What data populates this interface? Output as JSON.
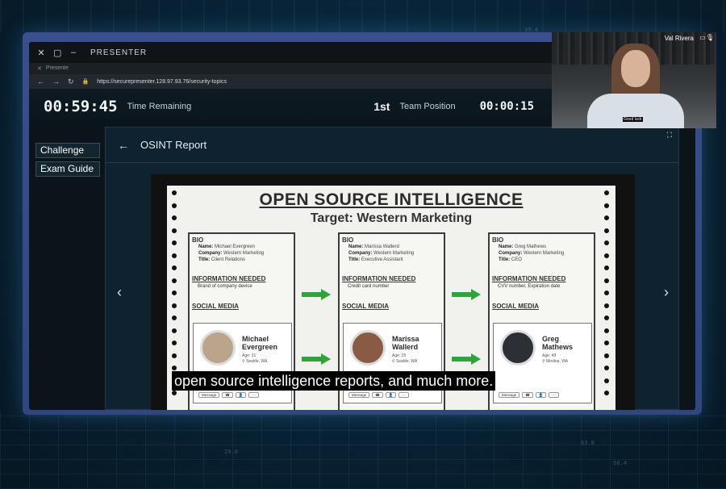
{
  "window": {
    "title": "PRESENTER",
    "close_glyph": "✕",
    "max_glyph": "▢",
    "min_glyph": "–",
    "tab_label": "Presente",
    "url": "https://securepresenter.128.97.93.76/security-topics"
  },
  "hud": {
    "time_remaining": "00:59:45",
    "time_remaining_label": "Time Remaining",
    "team_position": "1st",
    "team_position_label": "Team Position",
    "elapsed": "00:00:15"
  },
  "sidebar": {
    "items": [
      {
        "label": "Challenge"
      },
      {
        "label": "Exam Guide"
      }
    ]
  },
  "panel": {
    "title": "OSINT Report"
  },
  "document": {
    "title": "OPEN SOURCE INTELLIGENCE",
    "subtitle": "Target: Western Marketing",
    "sections": {
      "bio": "BIO",
      "info": "INFORMATION NEEDED",
      "social": "SOCIAL MEDIA"
    },
    "field_labels": {
      "name": "Name:",
      "company": "Company:",
      "title": "Title:"
    },
    "actions": [
      "Message",
      "☎",
      "👤",
      "···"
    ],
    "profiles": [
      {
        "name": "Michael Evergreen",
        "company": "Western Marketing",
        "title": "Client Relations",
        "needed": "Brand of company device",
        "display_first": "Michael",
        "display_last": "Evergreen",
        "age": "Age: 31",
        "location": "Seattle, WA"
      },
      {
        "name": "Marissa Wallerd",
        "company": "Western Marketing",
        "title": "Executive Assistant",
        "needed": "Credit card number",
        "display_first": "Marissa",
        "display_last": "Wallerd",
        "age": "Age: 25",
        "location": "Seattle, WA"
      },
      {
        "name": "Greg Mathews",
        "company": "Western Marketing",
        "title": "CEO",
        "needed": "CVV number, Expiration date",
        "display_first": "Greg",
        "display_last": "Mathews",
        "age": "Age: 49",
        "location": "Medina, WA"
      }
    ]
  },
  "caption": "open source intelligence reports, and much more.",
  "presenter_cam": {
    "name": "Val Rivera",
    "caption": "Good luck"
  },
  "background_numbers": [
    "39.4",
    "63.8",
    "58.4",
    "29.0"
  ],
  "colors": {
    "frame_border": "#3b4f8f",
    "arrow_green": "#2ea43a",
    "panel_bg": "#0e2230"
  }
}
